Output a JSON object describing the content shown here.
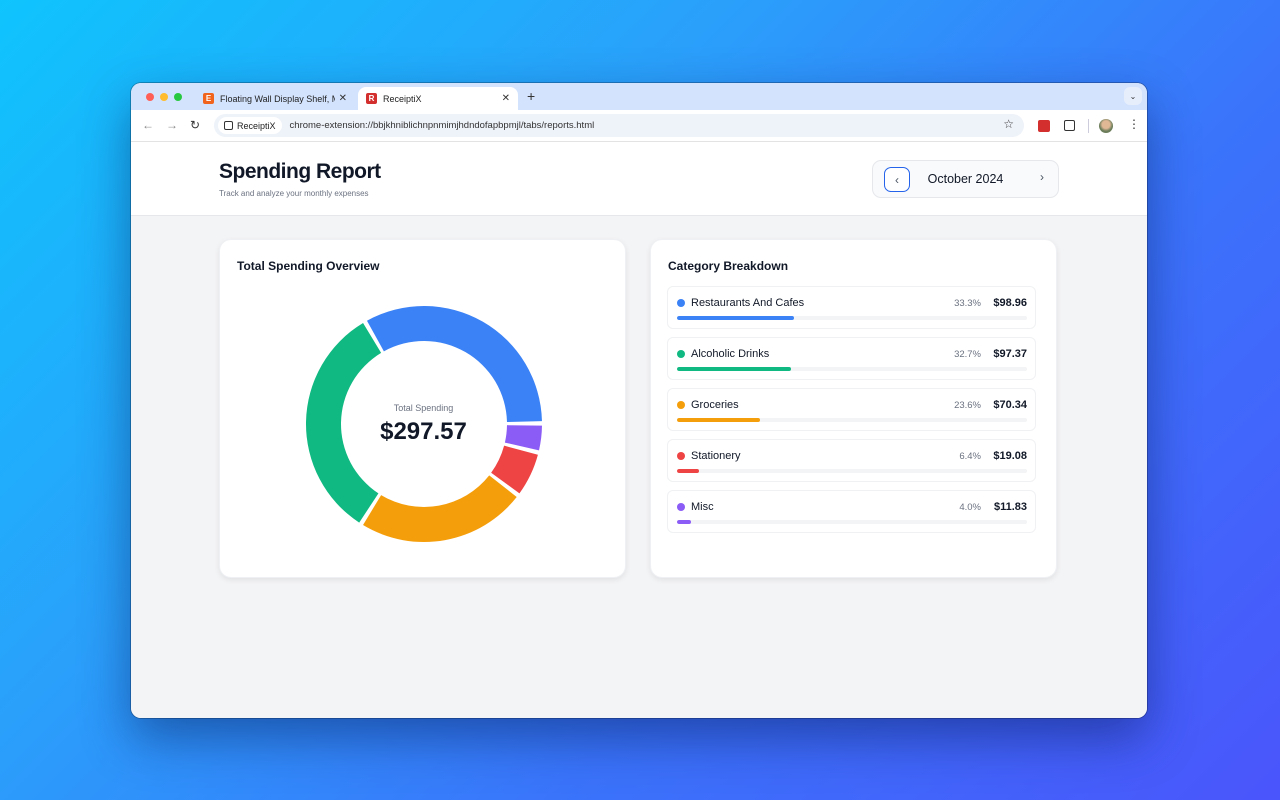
{
  "browser": {
    "tabs": [
      {
        "title": "Floating Wall Display Shelf, M",
        "favicon": "etsy-icon",
        "favicon_color": "#f1641e",
        "active": false
      },
      {
        "title": "ReceiptiX",
        "favicon": "receiptix-icon",
        "favicon_color": "#d32f2f",
        "active": true
      }
    ],
    "omnibox_chip": "ReceiptiX",
    "url": "chrome-extension://bbjkhniblichnpnmimjhdndofapbpmjl/tabs/reports.html"
  },
  "header": {
    "title": "Spending Report",
    "subtitle": "Track and analyze your monthly expenses",
    "month_label": "October 2024",
    "prev_glyph": "‹",
    "next_glyph": "›"
  },
  "overview": {
    "title": "Total Spending Overview",
    "center_label": "Total Spending",
    "total": "$297.57"
  },
  "breakdown": {
    "title": "Category Breakdown",
    "items": [
      {
        "name": "Restaurants And Cafes",
        "percent_label": "33.3%",
        "amount": "$98.96",
        "color": "#3b82f6"
      },
      {
        "name": "Alcoholic Drinks",
        "percent_label": "32.7%",
        "amount": "$97.37",
        "color": "#10b981"
      },
      {
        "name": "Groceries",
        "percent_label": "23.6%",
        "amount": "$70.34",
        "color": "#f59e0b"
      },
      {
        "name": "Stationery",
        "percent_label": "6.4%",
        "amount": "$19.08",
        "color": "#ef4444"
      },
      {
        "name": "Misc",
        "percent_label": "4.0%",
        "amount": "$11.83",
        "color": "#8b5cf6"
      }
    ]
  },
  "chart_data": {
    "type": "pie",
    "title": "Total Spending Overview",
    "categories": [
      "Restaurants And Cafes",
      "Misc",
      "Stationery",
      "Groceries",
      "Alcoholic Drinks"
    ],
    "values": [
      98.96,
      11.83,
      19.08,
      70.34,
      97.37
    ],
    "colors": [
      "#3b82f6",
      "#8b5cf6",
      "#ef4444",
      "#f59e0b",
      "#10b981"
    ],
    "center_label": "Total Spending",
    "center_value": "$297.57",
    "donut": true
  }
}
